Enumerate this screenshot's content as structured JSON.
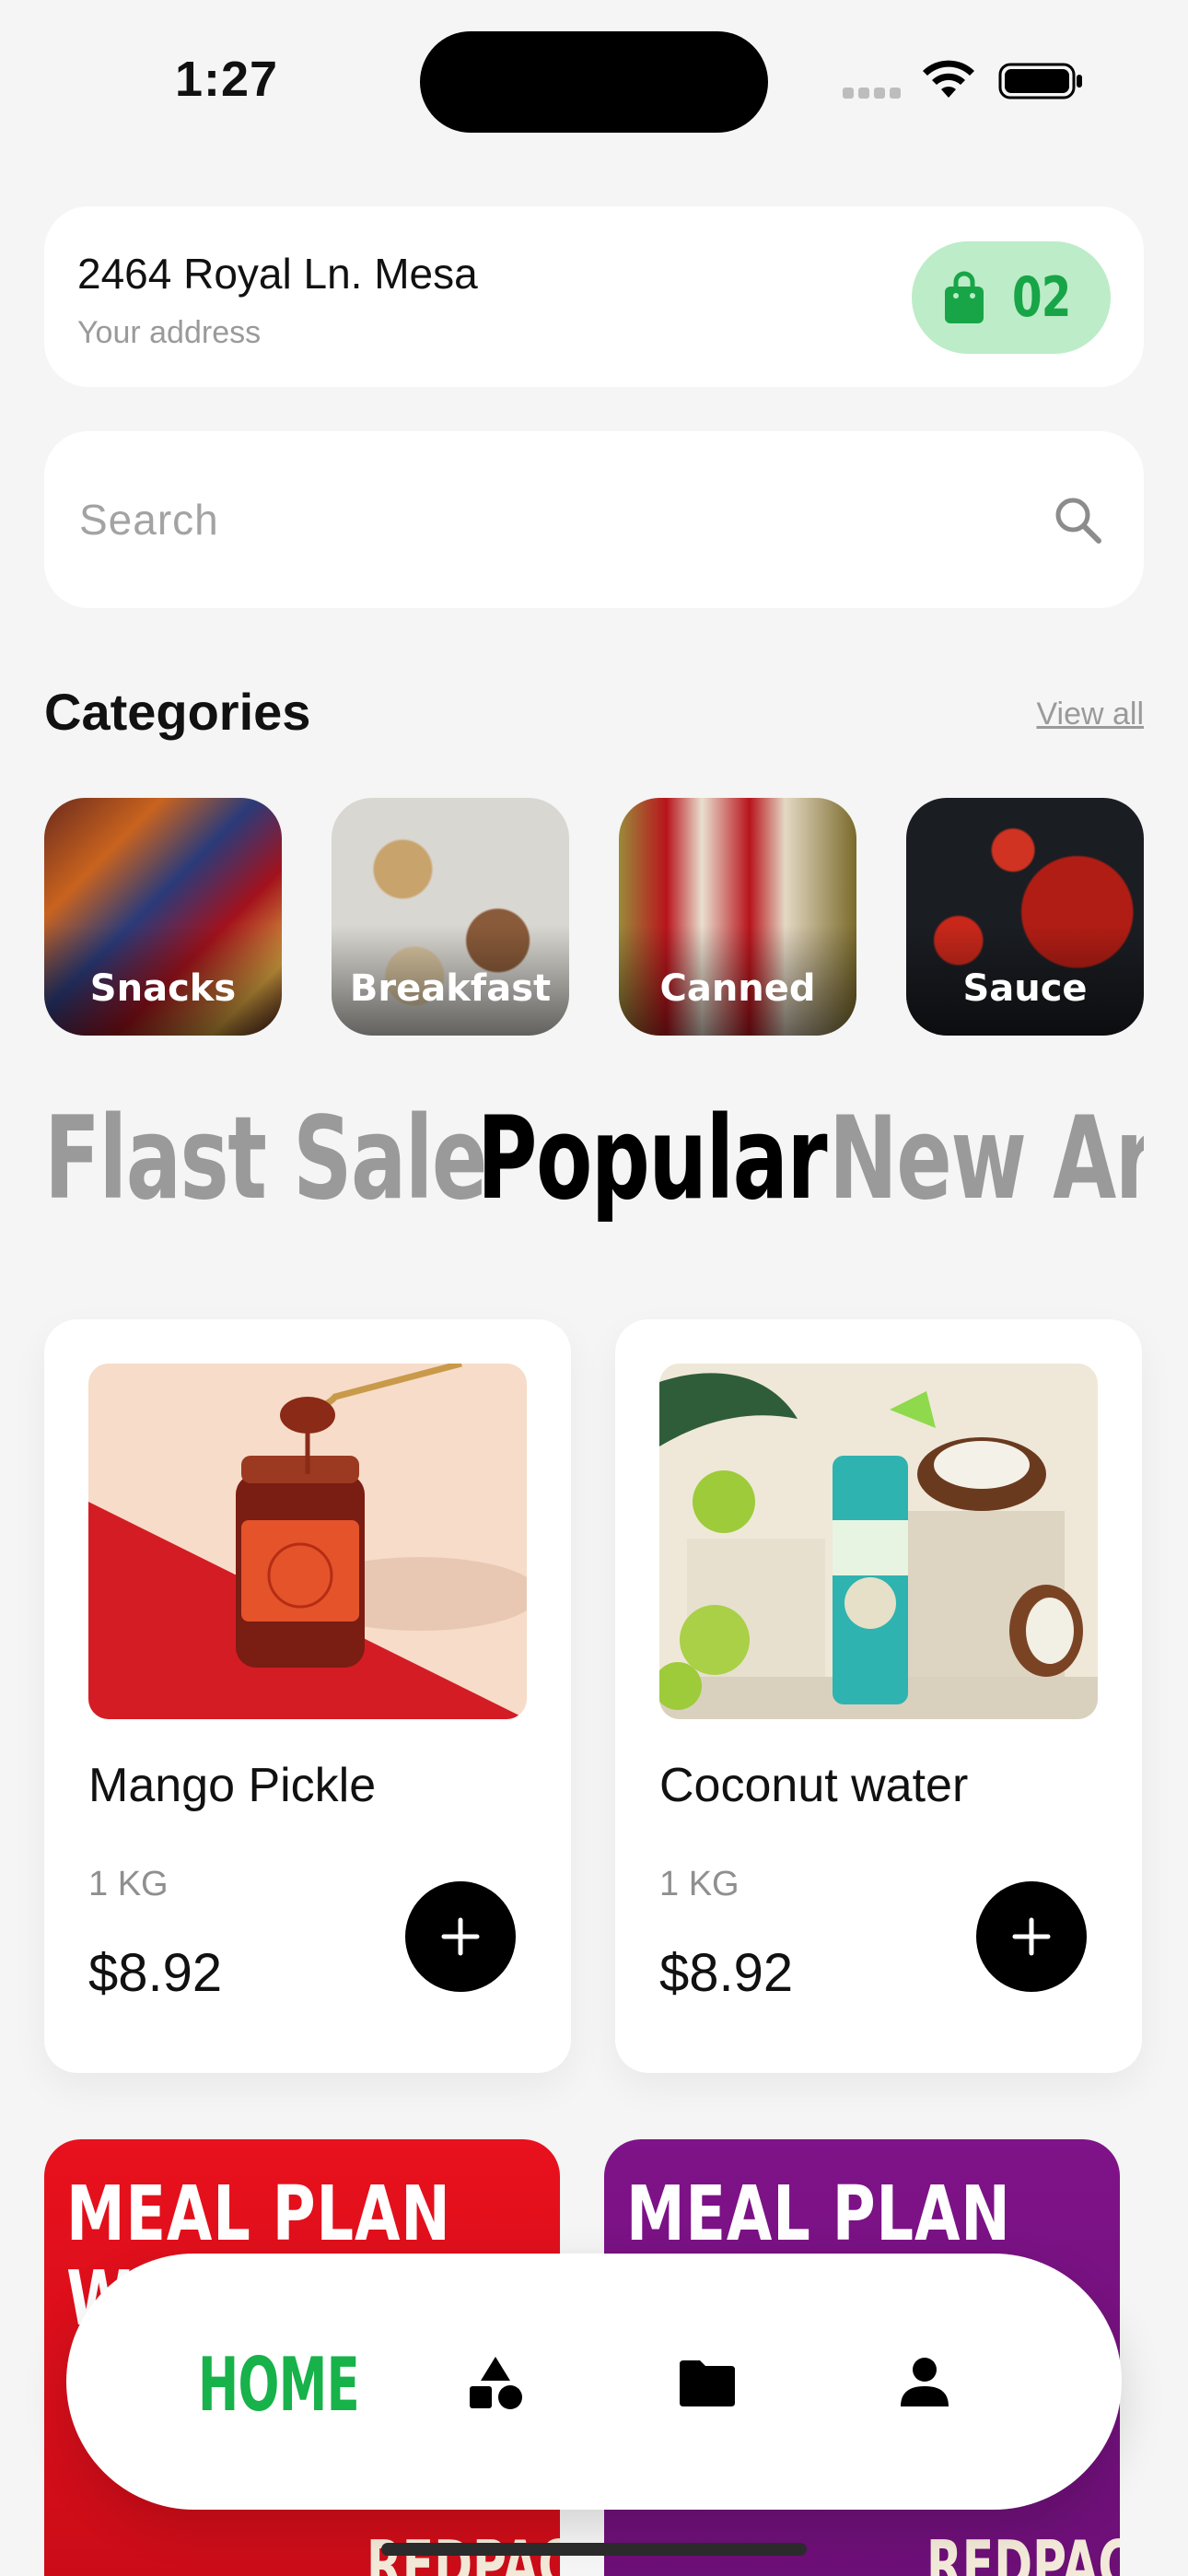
{
  "status_bar": {
    "time": "1:27"
  },
  "header": {
    "address": "2464 Royal Ln. Mesa",
    "address_caption": "Your address",
    "cart_count": "02"
  },
  "search": {
    "placeholder": "Search"
  },
  "categories": {
    "title": "Categories",
    "view_all": "View all",
    "items": [
      {
        "label": "Snacks"
      },
      {
        "label": "Breakfast"
      },
      {
        "label": "Canned"
      },
      {
        "label": "Sauce"
      }
    ]
  },
  "tabs": [
    {
      "label": "Flast Sale",
      "active": false
    },
    {
      "label": "Popular",
      "active": true
    },
    {
      "label": "New Arrivals",
      "active": false
    }
  ],
  "products": [
    {
      "name": "Mango Pickle",
      "weight": "1 KG",
      "price": "$8.92"
    },
    {
      "name": "Coconut water",
      "weight": "1 KG",
      "price": "$8.92"
    }
  ],
  "meal_plans": [
    {
      "title": "MEAL PLAN",
      "title_line2": "W",
      "partial_text": "REDPAC",
      "color": "#e1101c"
    },
    {
      "title": "MEAL PLAN",
      "partial_text": "REDPAC",
      "color": "#7a1283"
    }
  ],
  "bottom_nav": {
    "home_label": "HOME",
    "items": [
      "home",
      "shapes-icon",
      "folder-icon",
      "person-icon"
    ]
  },
  "colors": {
    "accent": "#17b24a",
    "cart_bg": "#bdecc8",
    "background": "#f4f5f4"
  }
}
